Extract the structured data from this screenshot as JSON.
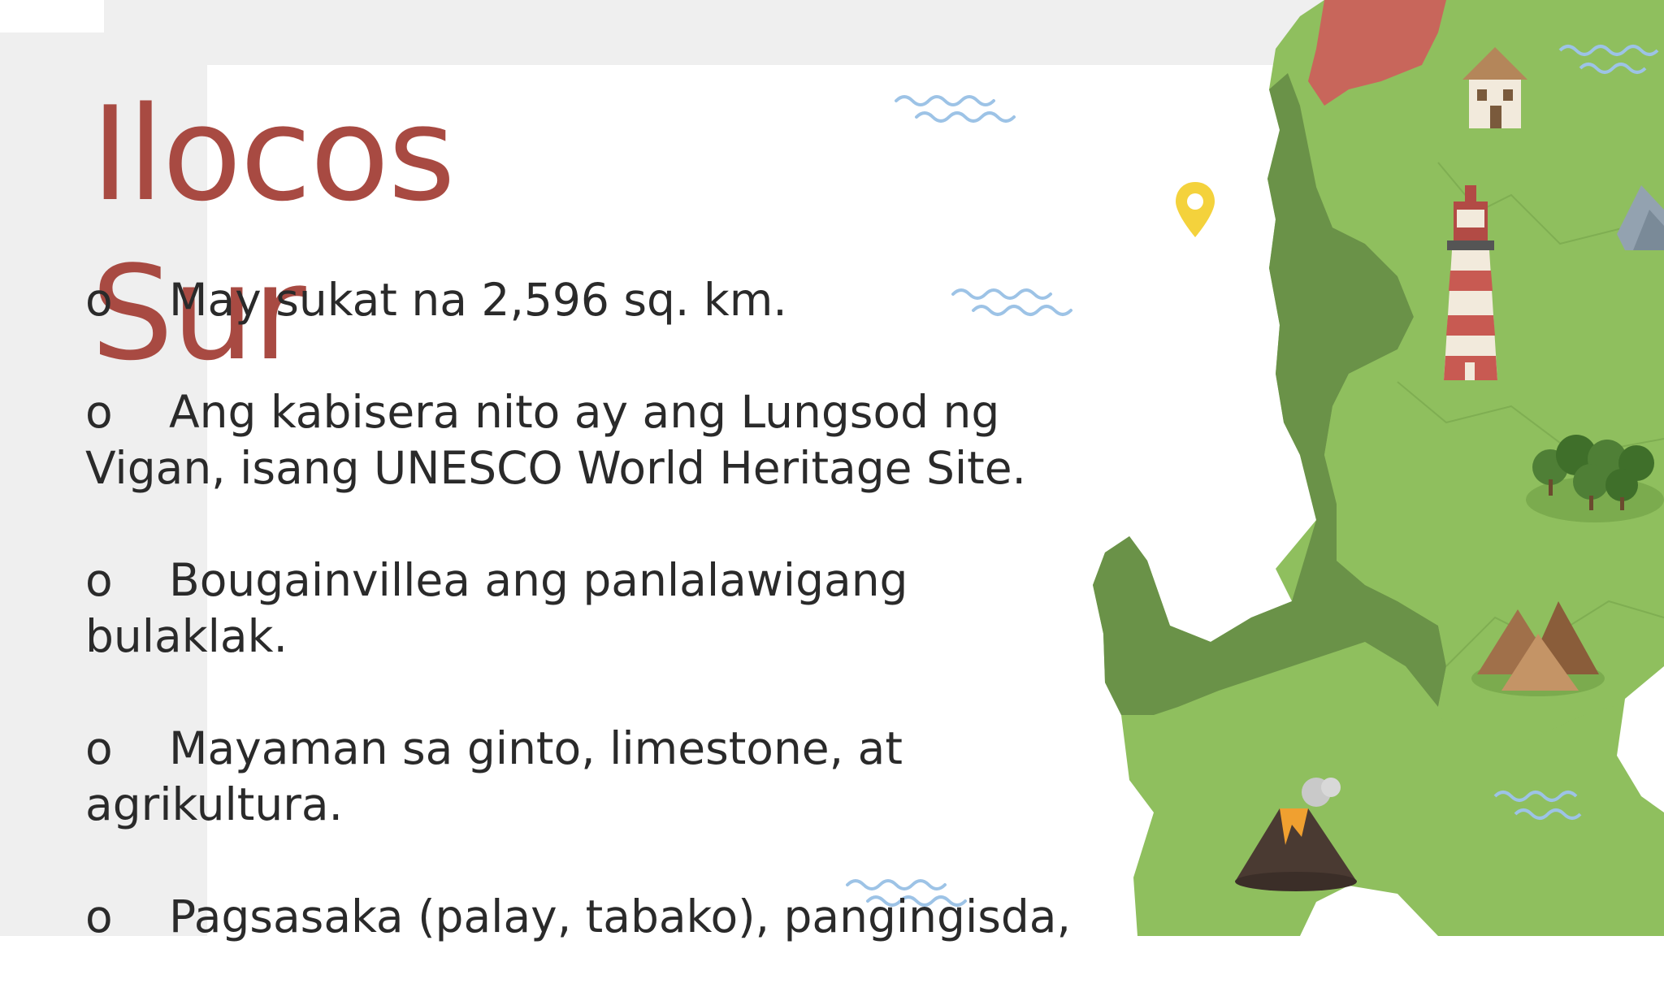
{
  "slide": {
    "title_line1": "Ilocos",
    "title_line2": "Sur",
    "title_color": "#a84a42",
    "bullet_marker": "o",
    "bullets": [
      "May sukat na 2,596 sq. km.",
      "Ang kabisera nito ay ang Lungsod ng Vigan, isang UNESCO World Heritage Site.",
      "Bougainvillea ang panlalawigang bulaklak.",
      "Mayaman sa ginto, limestone, at agrikultura.",
      "Pagsasaka (palay, tabako), pangingisda,"
    ]
  },
  "map": {
    "land_color": "#8fbf5e",
    "dark_land_color": "#6a9248",
    "highlight_color": "#c8665b",
    "water_wave_color": "#9dc3e6",
    "pin_color": "#f4d23c",
    "icons": [
      "house-icon",
      "lighthouse-icon",
      "mountain-icon",
      "forest-icon",
      "hills-icon",
      "volcano-icon"
    ]
  }
}
